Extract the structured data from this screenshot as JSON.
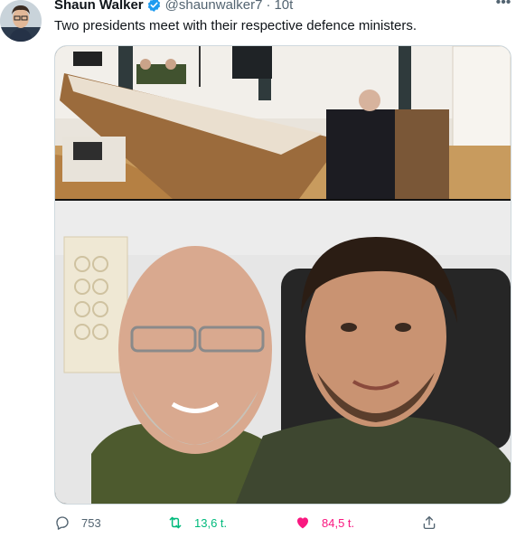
{
  "tweet": {
    "author_name": "Shaun Walker",
    "handle": "@shaunwalker7",
    "separator": "·",
    "time": "10t",
    "text": "Two presidents meet with their respective defence ministers.",
    "more_icon": "more-horizontal-icon",
    "verified_icon": "verified-badge-icon"
  },
  "actions": {
    "reply_count": "753",
    "retweet_count": "13,6 t.",
    "like_count": "84,5 t.",
    "retweet_color": "#00ba7c",
    "like_color": "#f91880"
  },
  "media": {
    "photo_count": 2,
    "photo_top_alt": "Long conference table meeting",
    "photo_bottom_alt": "Two men smiling selfie"
  }
}
